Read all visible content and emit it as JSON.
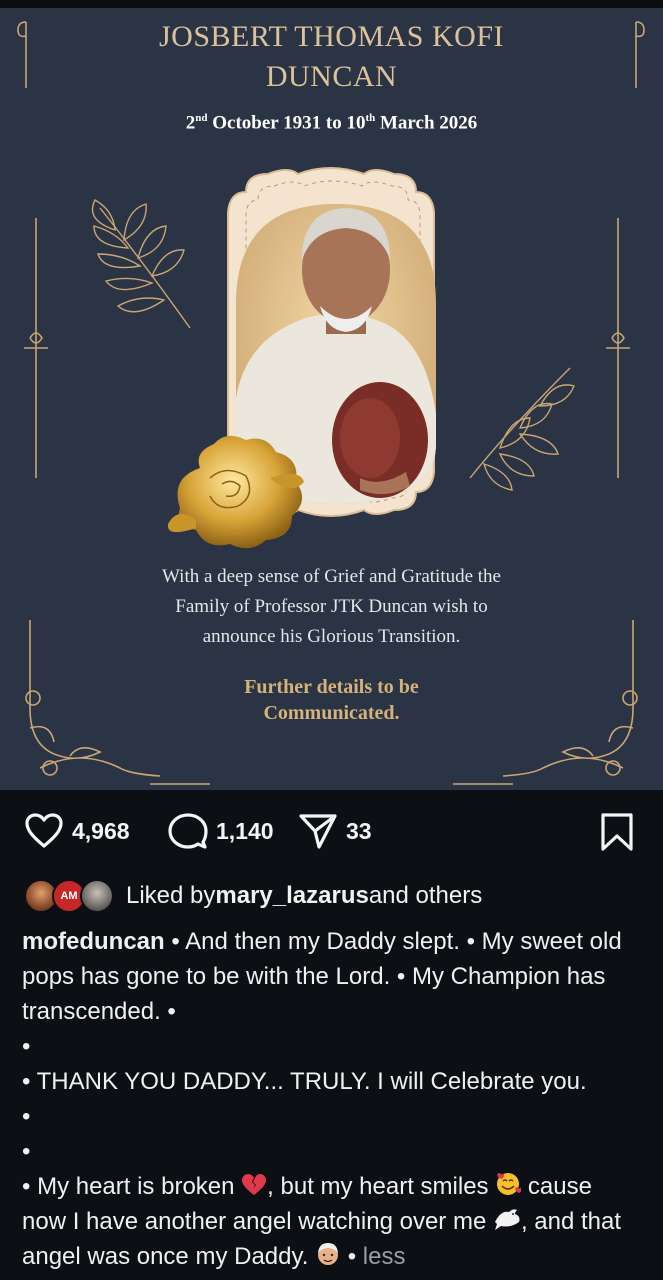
{
  "post_image": {
    "name_line1": "JOSBERT THOMAS KOFI",
    "name_line2": "DUNCAN",
    "dates": {
      "start_day": "2",
      "start_suffix": "nd",
      "start_rest": " October 1931 to 10",
      "end_suffix": "th",
      "end_rest": " March 2026"
    },
    "message_lines": [
      "With a deep sense of Grief and Gratitude the",
      "Family of Professor JTK Duncan wish to",
      "announce his Glorious Transition."
    ],
    "further_lines": [
      "Further details to be",
      "Communicated."
    ]
  },
  "actions": {
    "like_count": "4,968",
    "comment_count": "1,140",
    "share_count": "33"
  },
  "likes": {
    "prefix": "Liked by ",
    "user": "mary_lazarus",
    "suffix": " and others",
    "avatar_badge": "AM"
  },
  "caption": {
    "username": "mofeduncan",
    "text_1": " • And then my Daddy slept. • My sweet old pops has gone to be with the Lord. • My Champion has transcended. •",
    "bullet": "•",
    "text_2": "• THANK YOU DADDY... TRULY. I will Celebrate you.",
    "text_3a": "• My heart is broken ",
    "text_3b": ", but my heart smiles ",
    "text_3c": " cause now I have another angel watching over me ",
    "text_3d": ", and that angel was once my Daddy. ",
    "text_3e": " • ",
    "less_label": "less"
  },
  "colors": {
    "post_background": "#2a3445",
    "gold": "#d5b27a",
    "app_background": "#0c0f14"
  },
  "icons": [
    "heart-icon",
    "comment-icon",
    "share-icon",
    "bookmark-icon"
  ]
}
